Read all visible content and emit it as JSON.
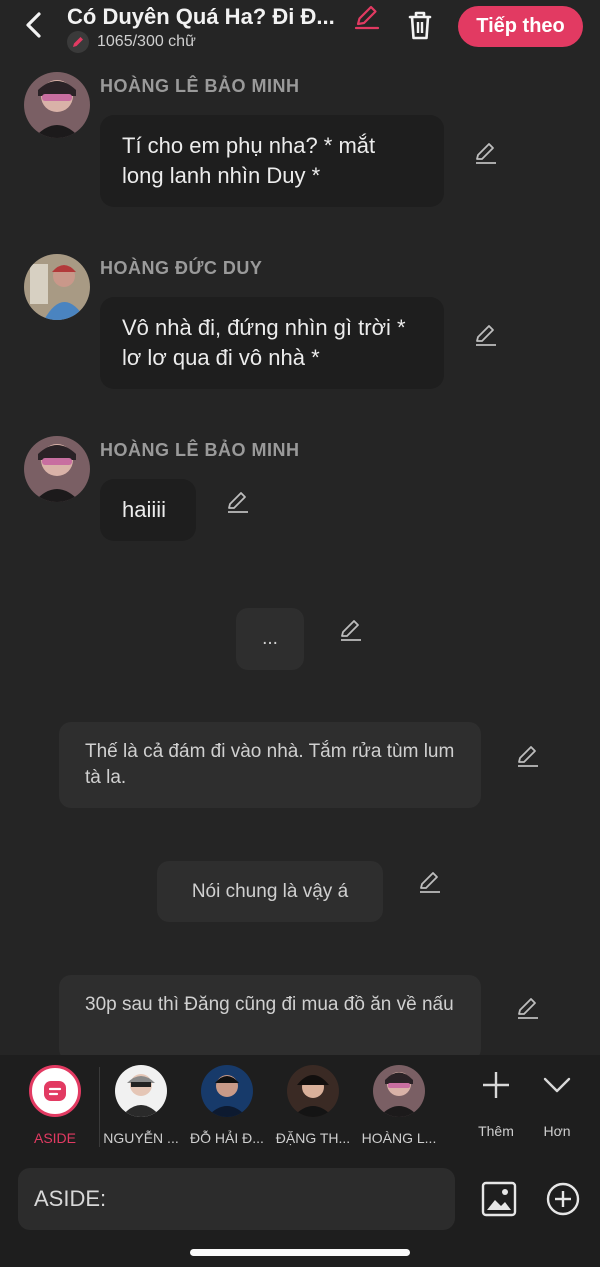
{
  "header": {
    "title": "Có Duyên Quá Ha? Đi Đ...",
    "word_count": "1065/300 chữ",
    "next_label": "Tiếp theo",
    "accent": "#e23a62"
  },
  "messages": [
    {
      "type": "character",
      "name": "HOÀNG LÊ BẢO MINH",
      "text": "Tí cho em phụ nha? * mắt long lanh nhìn Duy *"
    },
    {
      "type": "character",
      "name": "HOÀNG ĐỨC DUY",
      "text": "Vô nhà đi, đứng nhìn gì trời * lơ lơ qua đi vô nhà *"
    },
    {
      "type": "character",
      "name": "HOÀNG LÊ BẢO MINH",
      "text": "haiiii"
    },
    {
      "type": "narration",
      "text": "..."
    },
    {
      "type": "narration",
      "text": "Thế là cả đám đi vào nhà. Tắm rửa tùm lum tà la."
    },
    {
      "type": "narration",
      "text": "Nói chung là vậy á"
    },
    {
      "type": "narration",
      "text": "30p sau thì Đăng cũng đi mua đồ ăn về nấu"
    }
  ],
  "characters": [
    {
      "label": "ASIDE",
      "icon": "aside-icon"
    },
    {
      "label": "NGUYỄN ..."
    },
    {
      "label": "ĐỖ HẢI Đ..."
    },
    {
      "label": "ĐẶNG TH..."
    },
    {
      "label": "HOÀNG L..."
    }
  ],
  "actions": {
    "add_label": "Thêm",
    "more_label": "Hơn"
  },
  "input": {
    "value": "ASIDE:"
  }
}
